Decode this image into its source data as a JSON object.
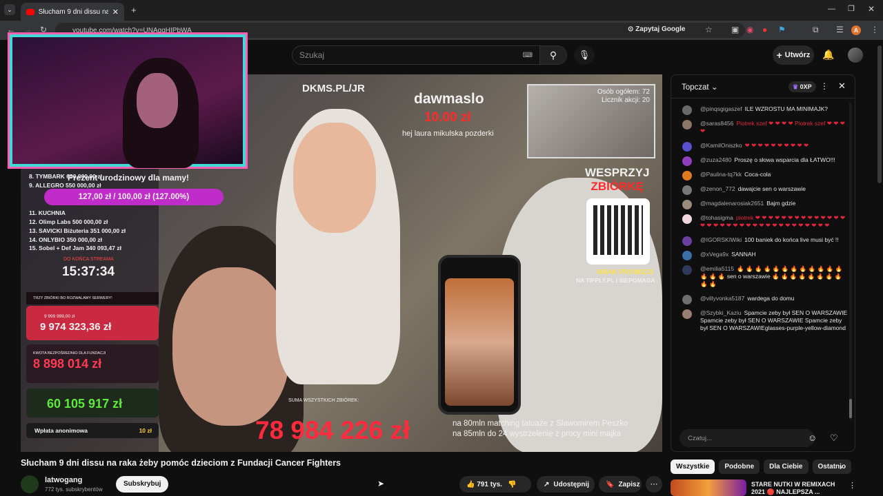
{
  "browser": {
    "tab_title": "Słucham 9 dni dissu na raka żeby",
    "url": "youtube.com/watch?v=UNAqqHIPbWA",
    "ask_google": "Zapytaj Google"
  },
  "header": {
    "search_placeholder": "Szukaj",
    "create_label": "Utwórz"
  },
  "video": {
    "webcam_caption": "Prezent urodzinowy dla mamy!",
    "webcam_goal": "127,00 zł / 100,00 zł (127.00%)",
    "site_label": "DKMS.PL/JR",
    "donor_name": "dawmaslo",
    "donation_amount": "10.00 zł",
    "donation_message": "hej laura mikulska pozderki",
    "counter_people": "Osób ogółem: 72",
    "counter_donations": "Licznik akcji: 20",
    "support_title_1": "WESPRZYJ",
    "support_title_2": "ZBIÓRKĘ",
    "no_commission": "BRAK PROWIZJI",
    "tipply": "NA TIPPLY.PL I SIEPOMAGA",
    "sponsors": [
      "8. TYMBARK 600 000,00 zł",
      "9. ALLEGRO 550 000,00 zł",
      "11. KUCHNIA",
      "12. Olimp Labs 500 000,00 zł",
      "13. SAVICKI Biżuteria 351 000,00 zł",
      "14. ONLYBIO 350 000,00 zł",
      "15. Sobel + Def Jam 340 093,47 zł"
    ],
    "countdown_label": "DO KOŃCA STREAMA",
    "countdown": "15:37:34",
    "three_funds": "TRZY ZBIÓRKI BO ROZWALAMY SERWERY!",
    "fund1_goal": "9 999 999,00 zł",
    "fund1": "9 974 323,36 zł",
    "fund2_label": "KWOTA BEZPOŚREDNIO DLA FUNDACJI",
    "fund2": "8 898 014 zł",
    "fund3": "60 105 917 zł",
    "anon_label": "Wpłata anonimowa",
    "anon_amount": "10 zł",
    "total_label": "SUMA WSZYSTKICH ZBIÓREK:",
    "total": "78 984 226 zł",
    "subtitle_1": "na 80mln matching tatuaże z Sławomirem Peszko",
    "subtitle_2": "na 85mln do 24 wystrzelenie z procy mini majka"
  },
  "below": {
    "title": "Słucham 9 dni dissu na raka żeby pomóc dzieciom z Fundacji Cancer Fighters",
    "channel": "latwogang",
    "subscribers": "772 tys. subskrybentów",
    "subscribe": "Subskrybuj",
    "likes": "791 tys.",
    "share": "Udostępnij",
    "save": "Zapisz"
  },
  "chat": {
    "title": "Topczat",
    "points": "0XP",
    "placeholder": "Czatuj...",
    "messages": [
      {
        "user": "@pinqsgigaszef",
        "text": "ILE WZROSTU MA MINIMAJK?",
        "color": "#6a6a6a"
      },
      {
        "user": "@saras8456",
        "text": "Piotrek szef ❤ ❤ ❤ ❤ Piotrek szef ❤ ❤ ❤ ❤",
        "color": "#8a7566"
      },
      {
        "user": "@KamilOniszko",
        "text": "❤ ❤ ❤ ❤ ❤ ❤ ❤ ❤ ❤ ❤",
        "color": "#5a4fcf"
      },
      {
        "user": "@zuza2480",
        "text": "Proszę o słowa wsparcia dla ŁATWO!!!",
        "color": "#8e3fbf"
      },
      {
        "user": "@Paulina-tq7kk",
        "text": "Coca-cola",
        "color": "#e07a1f"
      },
      {
        "user": "@zenon_772",
        "text": "dawajcie sen o warszawie",
        "color": "#777777"
      },
      {
        "user": "@magdalenarosiak2651",
        "text": "Bajm gdzie",
        "color": "#9c8a7a"
      },
      {
        "user": "@tohasigma",
        "text": "piotrek ❤ ❤ ❤ ❤ ❤ ❤ ❤ ❤ ❤ ❤ ❤ ❤ ❤ ❤ ❤ ❤ ❤ ❤ ❤ ❤ ❤ ❤ ❤ ❤ ❤ ❤ ❤ ❤ ❤ ❤ ❤ ❤ ❤ ❤",
        "color": "#f0d6dc"
      },
      {
        "user": "@IGORSKIWiki",
        "text": "100 baniek do końca live musi być !!",
        "color": "#6b3fa0"
      },
      {
        "user": "@xVega9x",
        "text": "SANNAH",
        "color": "#3b6fa8"
      },
      {
        "user": "@emilia5115",
        "text": "🔥 🔥 🔥 🔥 🔥 🔥 🔥 🔥 🔥 🔥 🔥 🔥 🔥 🔥 🔥 sen o warszawie 🔥 🔥 🔥 🔥 🔥 🔥 🔥 🔥 🔥 🔥",
        "color": "#2d3a5a"
      },
      {
        "user": "@villyvonka5187",
        "text": "wardega do domu",
        "color": "#6e6e6e"
      },
      {
        "user": "@Szybki_Kaziu",
        "text": "Spamcie zeby był SEN O WARSZAWIE Spamcie zeby był SEN O WARSZAWIE Spamcie zeby był SEN O WARSZAWIEglasses-purple-yellow-diamond",
        "color": "#9a7f74"
      }
    ],
    "chips": [
      "Wszystkie",
      "Podobne",
      "Dla Ciebie",
      "Ostatnio"
    ]
  },
  "recommended": {
    "title": "STARE NUTKI W REMIXACH 2021 🔴 NAJLEPSZA ..."
  }
}
